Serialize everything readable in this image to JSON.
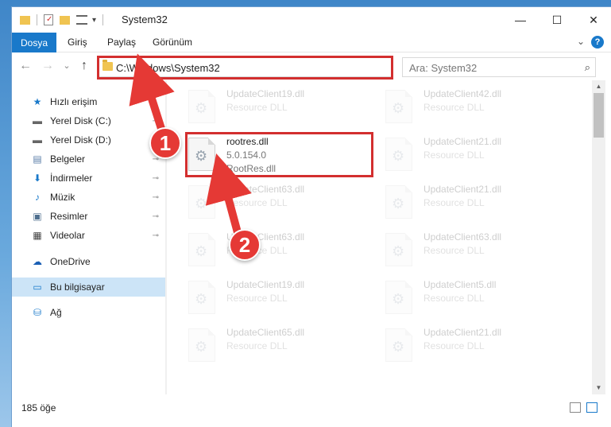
{
  "window": {
    "title": "System32",
    "controls": {
      "minimize": "—",
      "maximize": "☐",
      "close": "✕"
    }
  },
  "ribbon": {
    "tabs": [
      "Dosya",
      "Giriş",
      "Paylaş",
      "Görünüm"
    ],
    "help": "?",
    "expand": "⌄"
  },
  "nav": {
    "back": "←",
    "forward": "→",
    "recent": "⌄",
    "up": "↑",
    "address": "C:\\Windows\\System32",
    "address_dropdown": "⌄",
    "refresh": "↻",
    "search_placeholder": "Ara: System32",
    "search_icon": "search-icon"
  },
  "sidebar": {
    "items": [
      {
        "label": "Hızlı erişim",
        "icon": "star-icon",
        "glyph": "★",
        "color": "#1979ca",
        "pinned": false
      },
      {
        "label": "Yerel Disk (C:)",
        "icon": "drive-icon",
        "glyph": "▬",
        "color": "#666666",
        "pinned": true
      },
      {
        "label": "Yerel Disk (D:)",
        "icon": "drive-icon",
        "glyph": "▬",
        "color": "#666666",
        "pinned": true
      },
      {
        "label": "Belgeler",
        "icon": "documents-icon",
        "glyph": "▤",
        "color": "#5a7ea8",
        "pinned": true
      },
      {
        "label": "İndirmeler",
        "icon": "download-icon",
        "glyph": "⬇",
        "color": "#1979ca",
        "pinned": true
      },
      {
        "label": "Müzik",
        "icon": "music-icon",
        "glyph": "♪",
        "color": "#1979ca",
        "pinned": true
      },
      {
        "label": "Resimler",
        "icon": "pictures-icon",
        "glyph": "▣",
        "color": "#4f6f8f",
        "pinned": true
      },
      {
        "label": "Videolar",
        "icon": "video-icon",
        "glyph": "▦",
        "color": "#444444",
        "pinned": true
      },
      {
        "label": "OneDrive",
        "icon": "cloud-icon",
        "glyph": "☁",
        "color": "#1a5fb4",
        "pinned": false
      },
      {
        "label": "Bu bilgisayar",
        "icon": "computer-icon",
        "glyph": "▭",
        "color": "#1979ca",
        "pinned": false
      },
      {
        "label": "Ağ",
        "icon": "network-icon",
        "glyph": "⛁",
        "color": "#1979ca",
        "pinned": false
      }
    ],
    "pin_glyph": "📌"
  },
  "files": {
    "left": [
      {
        "name": "UpdateClient19.dll",
        "type": "Resource DLL",
        "faded": true
      },
      {
        "name": "rootres.dll",
        "version": "5.0.154.0",
        "type": "RootRes.dll",
        "faded": false
      },
      {
        "name": "UpdateClient63.dll",
        "type": "Resource DLL",
        "faded": true
      },
      {
        "name": "UpdateClient63.dll",
        "type": "Resource DLL",
        "faded": true
      },
      {
        "name": "UpdateClient19.dll",
        "type": "Resource DLL",
        "faded": true
      },
      {
        "name": "UpdateClient65.dll",
        "type": "Resource DLL",
        "faded": true
      }
    ],
    "right": [
      {
        "name": "UpdateClient42.dll",
        "type": "Resource DLL",
        "faded": true
      },
      {
        "name": "UpdateClient21.dll",
        "type": "Resource DLL",
        "faded": true
      },
      {
        "name": "UpdateClient21.dll",
        "type": "Resource DLL",
        "faded": true
      },
      {
        "name": "UpdateClient63.dll",
        "type": "Resource DLL",
        "faded": true
      },
      {
        "name": "UpdateClient5.dll",
        "type": "Resource DLL",
        "faded": true
      },
      {
        "name": "UpdateClient21.dll",
        "type": "Resource DLL",
        "faded": true
      }
    ]
  },
  "status": {
    "count": "185 öğe"
  },
  "annotations": {
    "step1": "1",
    "step2": "2",
    "highlight_color": "#d32f2f"
  }
}
